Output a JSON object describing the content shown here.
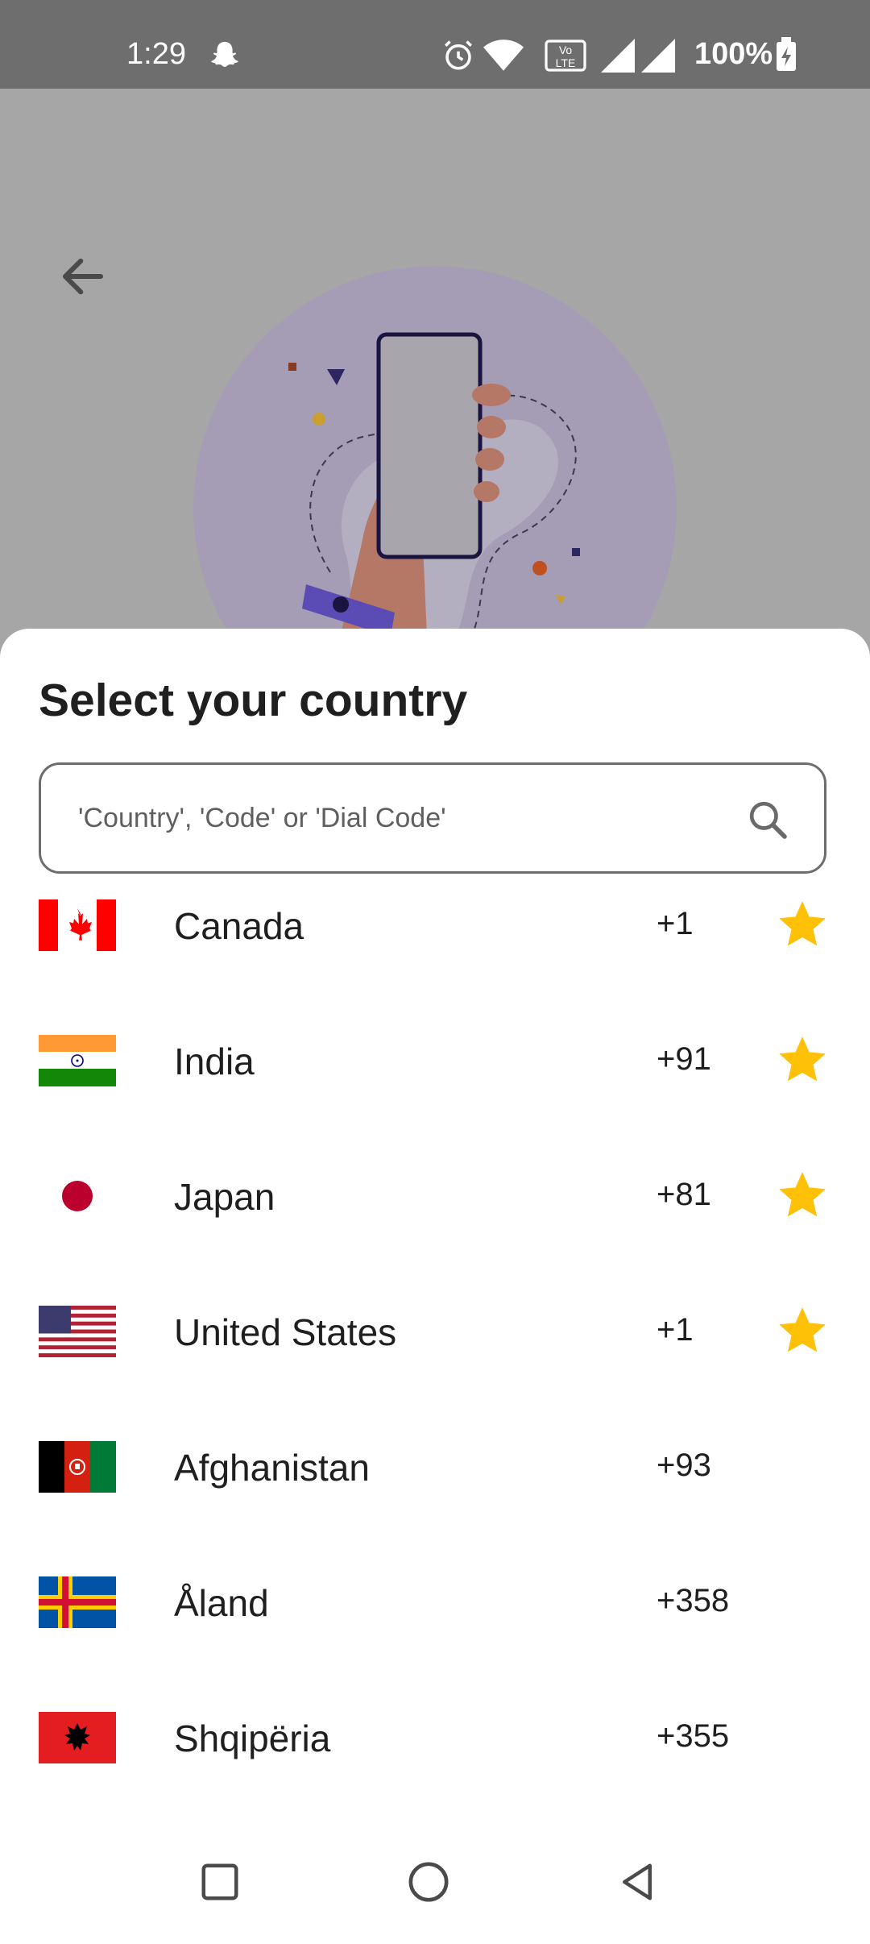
{
  "status_bar": {
    "time": "1:29",
    "battery": "100%",
    "icons": [
      "snapchat-icon",
      "alarm-icon",
      "wifi-icon",
      "volte-icon",
      "signal-icon",
      "signal-icon",
      "battery-charging-icon"
    ]
  },
  "header": {
    "back_icon": "arrow-back-icon"
  },
  "sheet": {
    "title": "Select your country",
    "search": {
      "placeholder": "'Country', 'Code' or 'Dial Code'",
      "value": "",
      "icon": "search-icon"
    },
    "countries": [
      {
        "name": "Canada",
        "dial_code": "+1",
        "flag": "flag-canada",
        "favorite": true
      },
      {
        "name": "India",
        "dial_code": "+91",
        "flag": "flag-india",
        "favorite": true
      },
      {
        "name": "Japan",
        "dial_code": "+81",
        "flag": "flag-japan",
        "favorite": true
      },
      {
        "name": "United States",
        "dial_code": "+1",
        "flag": "flag-united-states",
        "favorite": true
      },
      {
        "name": "Afghanistan",
        "dial_code": "+93",
        "flag": "flag-afghanistan",
        "favorite": false
      },
      {
        "name": "Åland",
        "dial_code": "+358",
        "flag": "flag-aland",
        "favorite": false
      },
      {
        "name": "Shqipëria",
        "dial_code": "+355",
        "flag": "flag-albania",
        "favorite": false
      }
    ]
  },
  "colors": {
    "star": "#FFC107",
    "dim_overlay": "#a6a6a6",
    "status_bar": "#6e6e6e",
    "illustration_circle": "#a49db5"
  },
  "nav_bar": {
    "buttons": [
      "recents-button",
      "home-button",
      "back-button"
    ]
  }
}
